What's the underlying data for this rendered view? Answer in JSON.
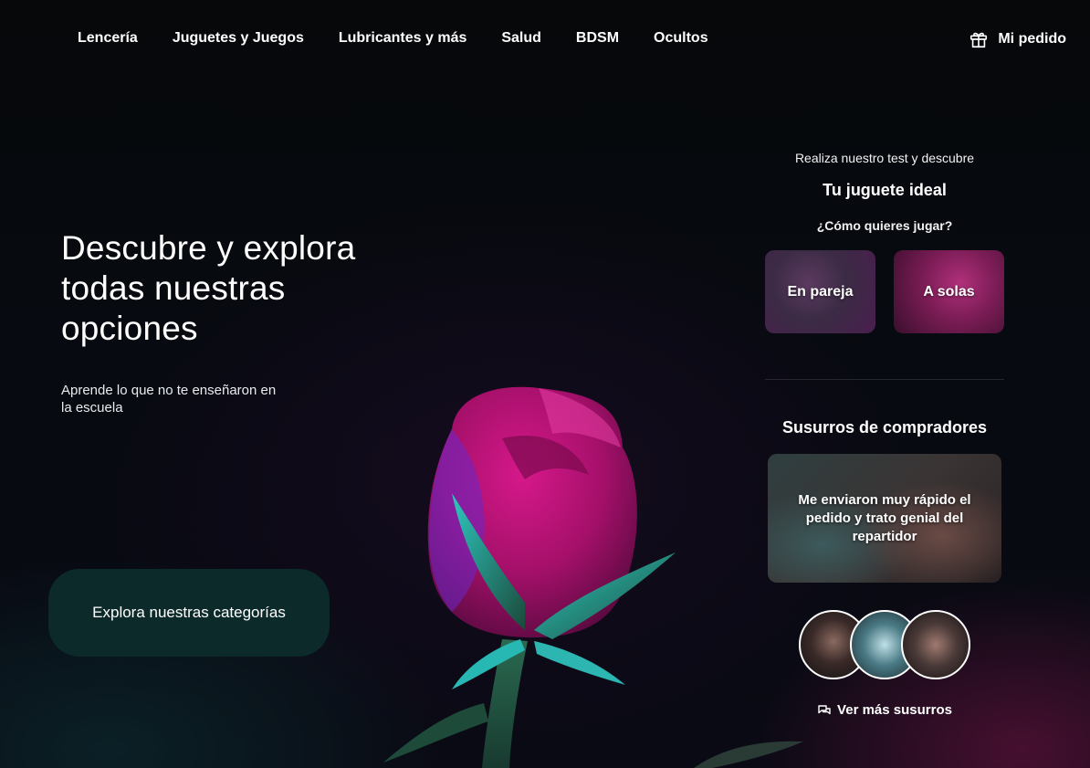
{
  "nav": {
    "items": [
      {
        "label": "Lencería"
      },
      {
        "label": "Juguetes y Juegos"
      },
      {
        "label": "Lubricantes y más"
      },
      {
        "label": "Salud"
      },
      {
        "label": "BDSM"
      },
      {
        "label": "Ocultos"
      }
    ],
    "order_label": "Mi pedido",
    "order_icon": "gift-icon"
  },
  "hero": {
    "title": "Descubre y explora todas nuestras opciones",
    "subtitle": "Aprende lo que no te enseñaron en la escuela",
    "cta_label": "Explora nuestras categorías"
  },
  "quiz": {
    "intro": "Realiza nuestro test y descubre",
    "title": "Tu juguete ideal",
    "question": "¿Cómo quieres jugar?",
    "options": [
      {
        "label": "En pareja"
      },
      {
        "label": "A solas"
      }
    ]
  },
  "whispers": {
    "title": "Susurros de compradores",
    "card_text": "Me enviaron muy rápido el pedido y trato genial del repartidor",
    "more_label": "Ver más susurros",
    "more_icon": "chat-bubbles-icon"
  },
  "colors": {
    "accent_pink": "#c0187a",
    "cta_bg": "#0d2a2a"
  }
}
